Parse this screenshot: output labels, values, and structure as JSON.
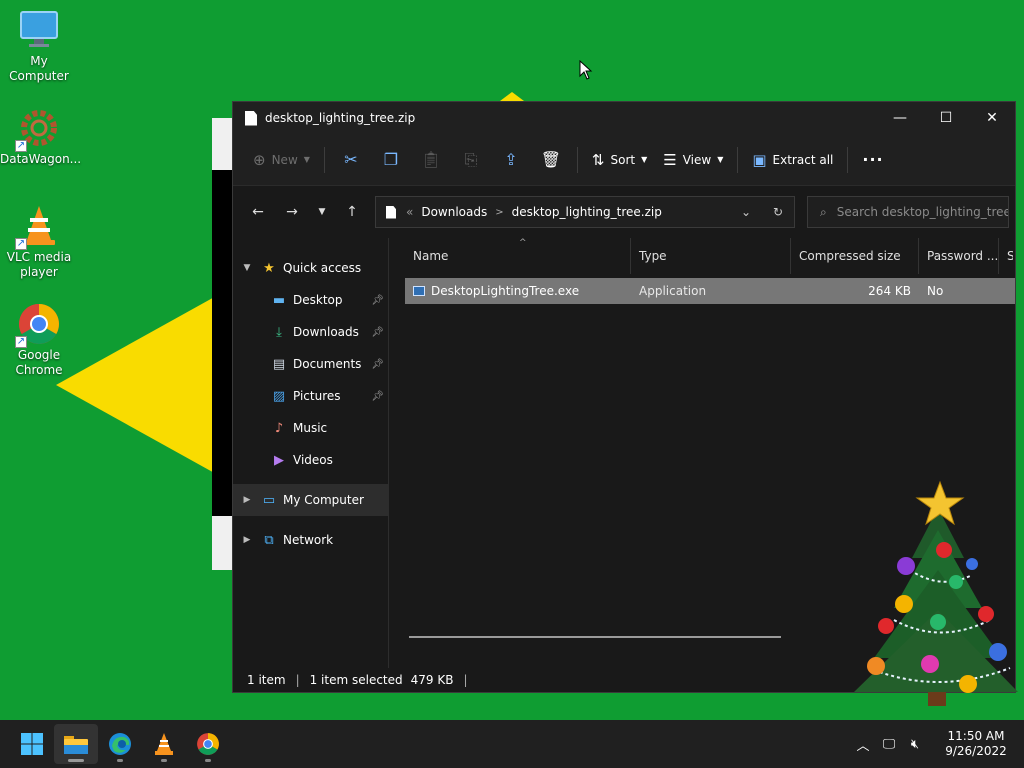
{
  "desktop": {
    "icons": [
      {
        "label": "My Computer"
      },
      {
        "label": "DataWagon..."
      },
      {
        "label": "VLC media player"
      },
      {
        "label": "Google Chrome"
      }
    ]
  },
  "window": {
    "title": "desktop_lighting_tree.zip",
    "controls": {
      "minimize": "—",
      "maximize": "☐",
      "close": "✕"
    }
  },
  "commandbar": {
    "new_label": "New",
    "sort_label": "Sort",
    "view_label": "View",
    "extract_label": "Extract all",
    "more_label": "···"
  },
  "address": {
    "overflow": "«",
    "crumbs": [
      "Downloads",
      "desktop_lighting_tree.zip"
    ],
    "search_placeholder": "Search desktop_lighting_tree..."
  },
  "nav": {
    "quick_access": "Quick access",
    "items": [
      {
        "label": "Desktop",
        "pinned": true
      },
      {
        "label": "Downloads",
        "pinned": true
      },
      {
        "label": "Documents",
        "pinned": true
      },
      {
        "label": "Pictures",
        "pinned": true
      },
      {
        "label": "Music",
        "pinned": false
      },
      {
        "label": "Videos",
        "pinned": false
      }
    ],
    "my_computer": "My Computer",
    "network": "Network"
  },
  "columns": {
    "name": "Name",
    "type": "Type",
    "compressed": "Compressed size",
    "password": "Password ...",
    "size": "Si"
  },
  "files": [
    {
      "name": "DesktopLightingTree.exe",
      "type": "Application",
      "compressed": "264 KB",
      "password": "No"
    }
  ],
  "status": {
    "count": "1 item",
    "selected": "1 item selected",
    "size": "479 KB"
  },
  "taskbar": {
    "time": "11:50 AM",
    "date": "9/26/2022"
  },
  "colors": {
    "desktop_bg": "#0f9d32",
    "window_bg": "#191919",
    "selection": "#777777",
    "accent_yellow": "#f9dc00"
  }
}
